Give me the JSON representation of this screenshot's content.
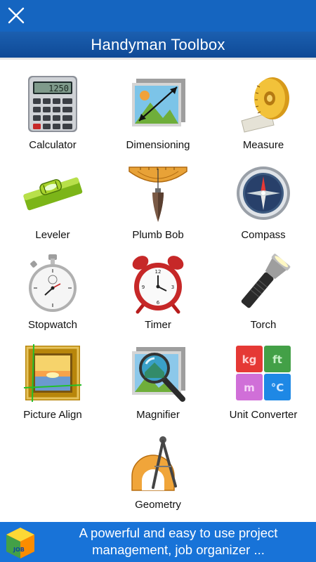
{
  "header": {
    "title": "Handyman Toolbox",
    "close_icon": "close-icon"
  },
  "tools": [
    {
      "label": "Calculator",
      "icon": "calculator-icon"
    },
    {
      "label": "Dimensioning",
      "icon": "dimensioning-icon"
    },
    {
      "label": "Measure",
      "icon": "tape-measure-icon"
    },
    {
      "label": "Leveler",
      "icon": "spirit-level-icon"
    },
    {
      "label": "Plumb Bob",
      "icon": "plumb-bob-icon"
    },
    {
      "label": "Compass",
      "icon": "compass-icon"
    },
    {
      "label": "Stopwatch",
      "icon": "stopwatch-icon"
    },
    {
      "label": "Timer",
      "icon": "alarm-clock-icon"
    },
    {
      "label": "Torch",
      "icon": "flashlight-icon"
    },
    {
      "label": "Picture Align",
      "icon": "picture-frame-icon"
    },
    {
      "label": "Magnifier",
      "icon": "magnifier-icon"
    },
    {
      "label": "Unit Converter",
      "icon": "unit-converter-icon"
    },
    {
      "label": "Geometry",
      "icon": "geometry-icon"
    }
  ],
  "calculator_display": "1250",
  "unit_converter_tiles": [
    "kg",
    "ft",
    "m",
    "°C"
  ],
  "ad": {
    "text": "A powerful and easy to use project management, job organizer ...",
    "logo_text": "JOB"
  },
  "colors": {
    "topbar": "#1565c0",
    "titlebar": "#1b5fb0",
    "ad_background": "#1873d8"
  }
}
